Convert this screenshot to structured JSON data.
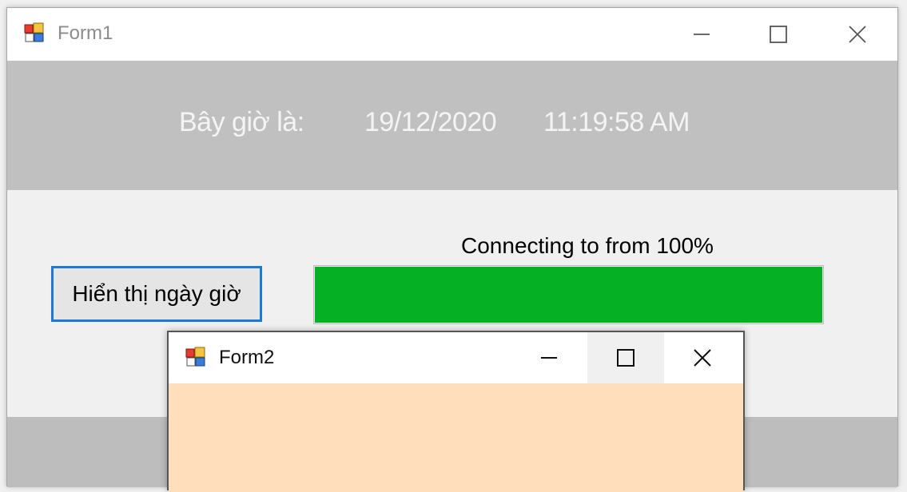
{
  "form1": {
    "title": "Form1",
    "date_panel": {
      "label": "Bây giờ là:",
      "date": "19/12/2020",
      "time": "11:19:58 AM"
    },
    "show_button_label": "Hiển thị ngày giờ",
    "progress": {
      "label": "Connecting to from 100%",
      "value_percent": 100,
      "fill_color": "#06b025"
    },
    "colors": {
      "date_panel_bg": "#c0c0c0",
      "focus_border": "#1b78d6"
    }
  },
  "form2": {
    "title": "Form2",
    "body_color": "#ffdfbb"
  },
  "icons": {
    "app_icon": "winforms-app-icon",
    "minimize": "minimize-icon",
    "maximize": "maximize-icon",
    "close": "close-icon"
  }
}
